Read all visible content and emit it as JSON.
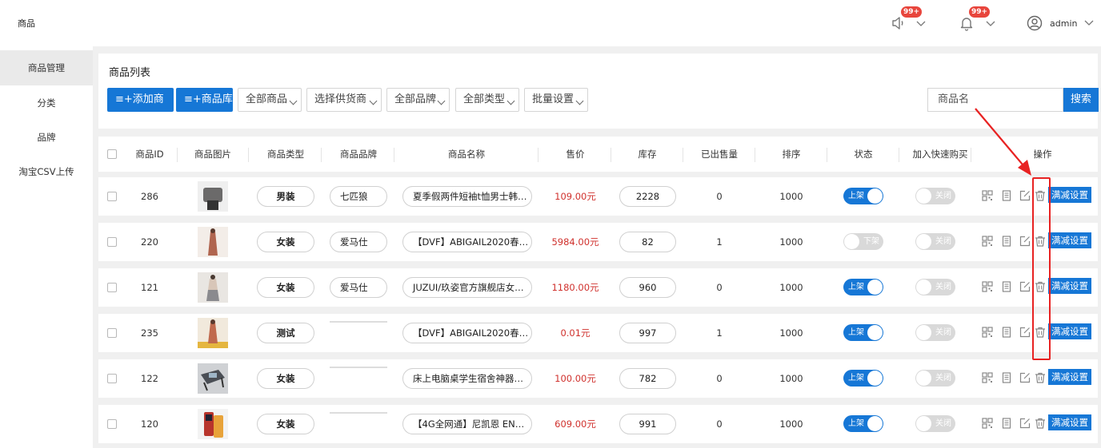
{
  "app": {
    "title": "商品"
  },
  "topbar": {
    "notice_badge": "99+",
    "bell_badge": "99+",
    "user_name": "admin"
  },
  "sidebar": {
    "items": [
      {
        "label": "商品管理",
        "active": true
      },
      {
        "label": "分类",
        "active": false
      },
      {
        "label": "品牌",
        "active": false
      },
      {
        "label": "淘宝CSV上传",
        "active": false
      }
    ]
  },
  "panel": {
    "title": "商品列表",
    "add_button": "≡+添加商品",
    "library_button": "≡+商品库",
    "filters": [
      "全部商品",
      "选择供货商",
      "全部品牌",
      "全部类型",
      "批量设置"
    ],
    "search_placeholder": "商品名",
    "search_button": "搜索"
  },
  "table": {
    "columns": [
      "商品ID",
      "商品图片",
      "商品类型",
      "商品品牌",
      "商品名称",
      "售价",
      "库存",
      "已出售量",
      "排序",
      "状态",
      "加入快速购买",
      "操作"
    ],
    "discount_label": "满减设置",
    "rows": [
      {
        "id": "286",
        "type": "男装",
        "brand": "七匹狼",
        "name": "夏季假两件短袖t恤男士韩…",
        "price": "109.00元",
        "stock": "2228",
        "sold": "0",
        "sort": "1000",
        "status": "上架",
        "status_on": true,
        "quick": "关闭",
        "thumb_color": "#6b6a6a"
      },
      {
        "id": "220",
        "type": "女装",
        "brand": "爱马仕",
        "name": "【DVF】ABIGAIL2020春…",
        "price": "5984.00元",
        "stock": "82",
        "sold": "1",
        "sort": "1000",
        "status": "下架",
        "status_on": false,
        "quick": "关闭",
        "thumb_color": "#b0654f"
      },
      {
        "id": "121",
        "type": "女装",
        "brand": "爱马仕",
        "name": "JUZUI/玖姿官方旗舰店女…",
        "price": "1180.00元",
        "stock": "960",
        "sold": "0",
        "sort": "1000",
        "status": "上架",
        "status_on": true,
        "quick": "关闭",
        "thumb_color": "#8a8a8e"
      },
      {
        "id": "235",
        "type": "测试",
        "brand": "",
        "name": "【DVF】ABIGAIL2020春…",
        "price": "0.01元",
        "stock": "997",
        "sold": "1",
        "sort": "1000",
        "status": "上架",
        "status_on": true,
        "quick": "关闭",
        "thumb_color": "#c06a4e"
      },
      {
        "id": "122",
        "type": "女装",
        "brand": "",
        "name": "床上电脑桌学生宿舍神器…",
        "price": "100.00元",
        "stock": "782",
        "sold": "0",
        "sort": "1000",
        "status": "上架",
        "status_on": true,
        "quick": "关闭",
        "thumb_color": "#4a4e55"
      },
      {
        "id": "120",
        "type": "女装",
        "brand": "",
        "name": "【4G全网通】尼凯恩 EN…",
        "price": "609.00元",
        "stock": "991",
        "sold": "0",
        "sort": "1000",
        "status": "上架",
        "status_on": true,
        "quick": "关闭",
        "thumb_color": "#b8352c"
      }
    ]
  },
  "colors": {
    "accent": "#1677d6",
    "price": "#d0312d",
    "annotation": "#e82222"
  }
}
